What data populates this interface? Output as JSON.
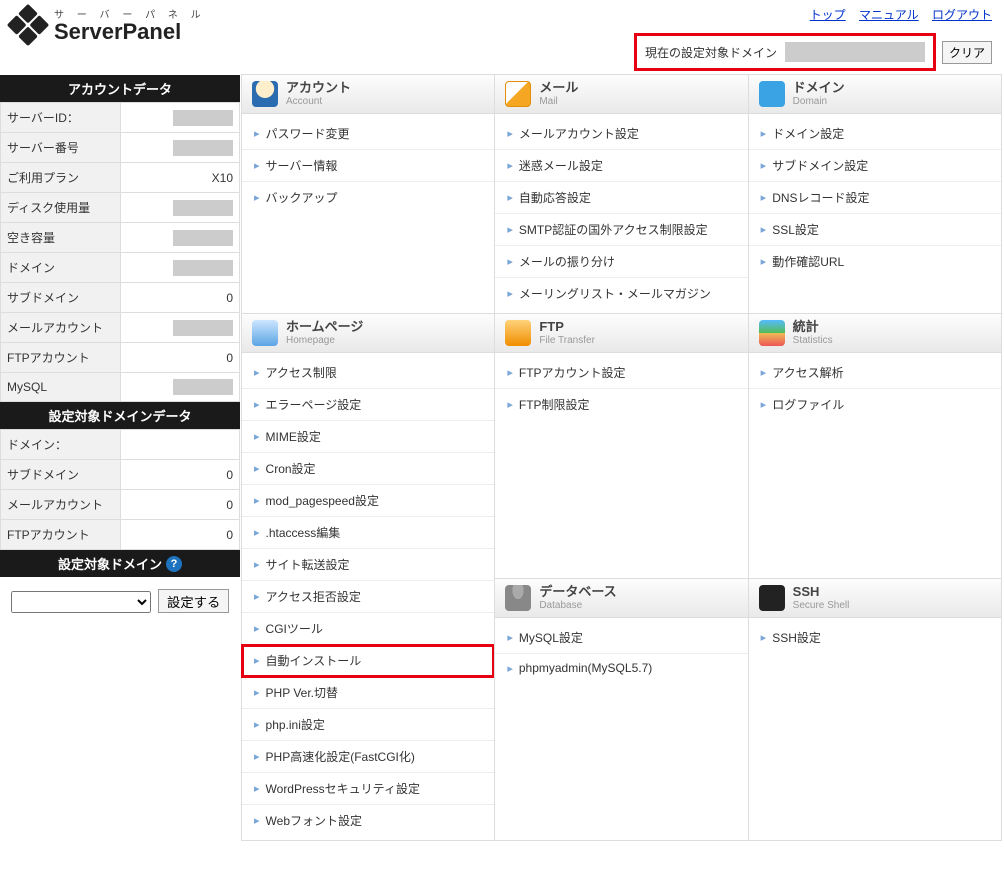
{
  "header": {
    "ruby": "サ ー バ ー パ ネ ル",
    "title": "ServerPanel",
    "links": {
      "top": "トップ",
      "manual": "マニュアル",
      "logout": "ログアウト"
    },
    "domainBox": {
      "label": "現在の設定対象ドメイン",
      "clear": "クリア"
    }
  },
  "sidebar": {
    "accountTitle": "アカウントデータ",
    "account": [
      {
        "k": "サーバーID：",
        "v": "",
        "gray": true
      },
      {
        "k": "サーバー番号",
        "v": "",
        "gray": true
      },
      {
        "k": "ご利用プラン",
        "v": "X10"
      },
      {
        "k": "ディスク使用量",
        "v": "",
        "gray": true
      },
      {
        "k": "空き容量",
        "v": "",
        "gray": true
      },
      {
        "k": "ドメイン",
        "v": "",
        "gray": true
      },
      {
        "k": "サブドメイン",
        "v": "0"
      },
      {
        "k": "メールアカウント",
        "v": "",
        "gray": true
      },
      {
        "k": "FTPアカウント",
        "v": "0"
      },
      {
        "k": "MySQL",
        "v": "",
        "gray": true
      }
    ],
    "targetDomainDataTitle": "設定対象ドメインデータ",
    "targetDomain": [
      {
        "k": "ドメイン：",
        "v": ""
      },
      {
        "k": "サブドメイン",
        "v": "0"
      },
      {
        "k": "メールアカウント",
        "v": "0"
      },
      {
        "k": "FTPアカウント",
        "v": "0"
      }
    ],
    "targetSelectTitle": "設定対象ドメイン",
    "setBtn": "設定する"
  },
  "cats": [
    {
      "jp": "アカウント",
      "en": "Account",
      "icon": "icn-account",
      "items": [
        "パスワード変更",
        "サーバー情報",
        "バックアップ"
      ]
    },
    {
      "jp": "メール",
      "en": "Mail",
      "icon": "icn-mail",
      "items": [
        "メールアカウント設定",
        "迷惑メール設定",
        "自動応答設定",
        "SMTP認証の国外アクセス制限設定",
        "メールの振り分け",
        "メーリングリスト・メールマガジン"
      ]
    },
    {
      "jp": "ドメイン",
      "en": "Domain",
      "icon": "icn-domain",
      "items": [
        "ドメイン設定",
        "サブドメイン設定",
        "DNSレコード設定",
        "SSL設定",
        "動作確認URL"
      ]
    },
    {
      "jp": "ホームページ",
      "en": "Homepage",
      "icon": "icn-home",
      "items": [
        "アクセス制限",
        "エラーページ設定",
        "MIME設定",
        "Cron設定",
        "mod_pagespeed設定",
        ".htaccess編集",
        "サイト転送設定",
        "アクセス拒否設定",
        "CGIツール",
        "自動インストール",
        "PHP Ver.切替",
        "php.ini設定",
        "PHP高速化設定(FastCGI化)",
        "WordPressセキュリティ設定",
        "Webフォント設定"
      ],
      "highlight": 9
    },
    {
      "jp": "FTP",
      "en": "File Transfer",
      "icon": "icn-ftp",
      "items": [
        "FTPアカウント設定",
        "FTP制限設定"
      ]
    },
    {
      "jp": "統計",
      "en": "Statistics",
      "icon": "icn-stat",
      "items": [
        "アクセス解析",
        "ログファイル"
      ]
    },
    {
      "jp": "データベース",
      "en": "Database",
      "icon": "icn-db",
      "items": [
        "MySQL設定",
        "phpmyadmin(MySQL5.7)"
      ],
      "skipCol": true
    },
    {
      "jp": "SSH",
      "en": "Secure Shell",
      "icon": "icn-ssh",
      "items": [
        "SSH設定"
      ]
    }
  ]
}
